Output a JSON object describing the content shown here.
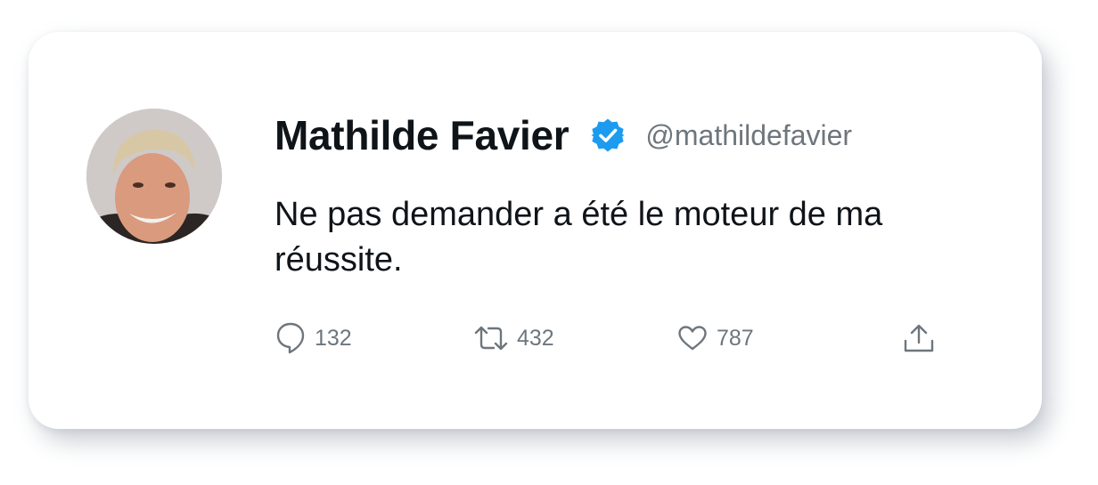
{
  "tweet": {
    "author_name": "Mathilde Favier",
    "handle": "@mathildefavier",
    "verified": true,
    "text": "Ne pas demander a été le moteur de ma réussite.",
    "avatar_icon": "profile-photo",
    "accent_color": "#1d9bf0"
  },
  "actions": {
    "reply": {
      "icon": "reply-bubble-icon",
      "count": "132"
    },
    "retweet": {
      "icon": "retweet-icon",
      "count": "432"
    },
    "like": {
      "icon": "heart-icon",
      "count": "787"
    },
    "share": {
      "icon": "share-upload-icon"
    }
  }
}
